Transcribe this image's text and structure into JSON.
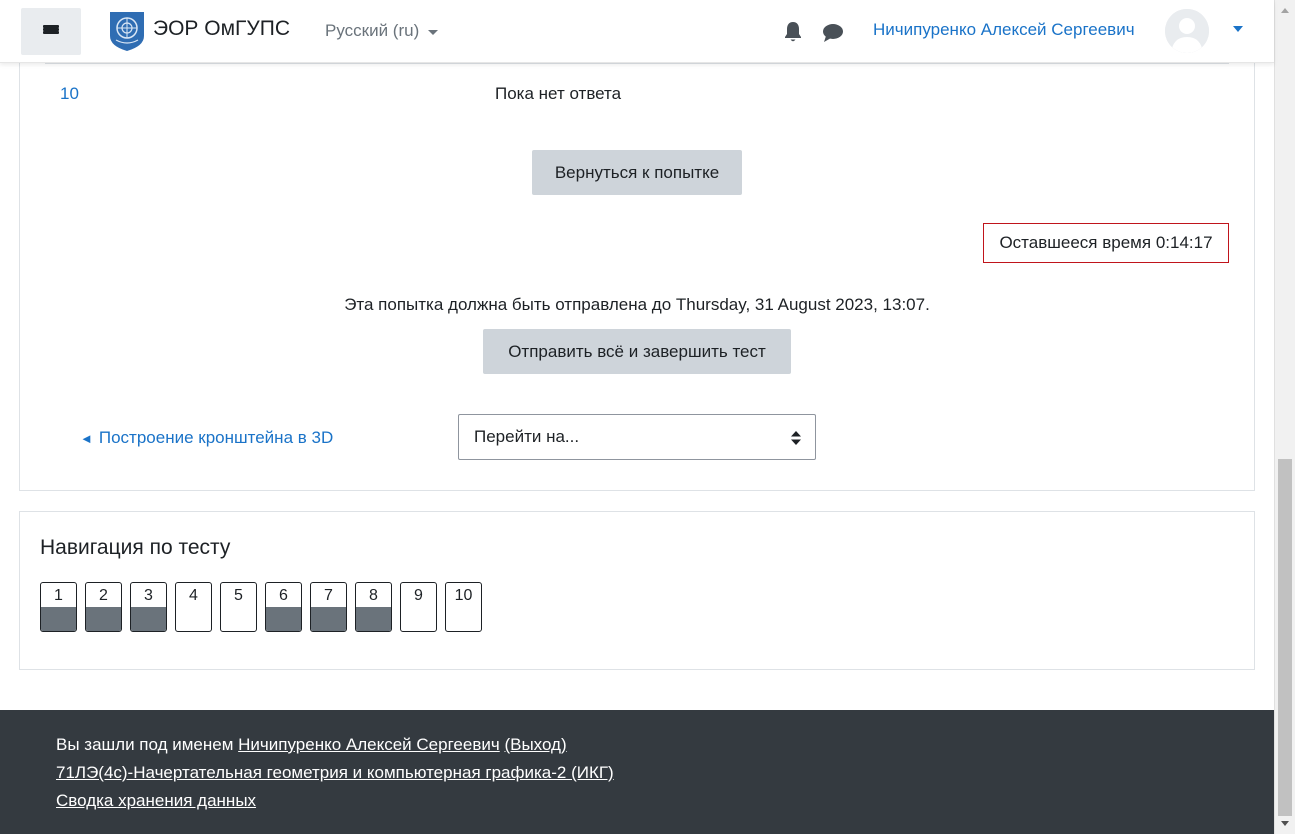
{
  "header": {
    "site_name": "ЭОР ОмГУПС",
    "language": "Русский (ru)",
    "user_name": "Ничипуренко Алексей Сергеевич"
  },
  "main": {
    "question_number": "10",
    "question_status": "Пока нет ответа",
    "return_button": "Вернуться к попытке",
    "timer_label": "Оставшееся время",
    "timer_value": "0:14:17",
    "deadline_text": "Эта попытка должна быть отправлена до Thursday, 31 August 2023, 13:07.",
    "submit_button": "Отправить всё и завершить тест",
    "prev_activity_link": "Построение кронштейна в 3D",
    "jump_to_placeholder": "Перейти на..."
  },
  "quiz_navigation": {
    "title": "Навигация по тесту",
    "questions": [
      {
        "label": "1",
        "answered": true
      },
      {
        "label": "2",
        "answered": true
      },
      {
        "label": "3",
        "answered": true
      },
      {
        "label": "4",
        "answered": false
      },
      {
        "label": "5",
        "answered": false
      },
      {
        "label": "6",
        "answered": true
      },
      {
        "label": "7",
        "answered": true
      },
      {
        "label": "8",
        "answered": true
      },
      {
        "label": "9",
        "answered": false
      },
      {
        "label": "10",
        "answered": false
      }
    ]
  },
  "footer": {
    "logged_in_prefix": "Вы зашли под именем",
    "user_name": "Ничипуренко Алексей Сергеевич",
    "logout_link": "(Выход)",
    "course_link": "71ЛЭ(4с)-Начертательная геометрия и компьютерная графика-2 (ИКГ)",
    "data_retention_link": "Сводка хранения данных"
  },
  "colors": {
    "link": "#1a73c8",
    "timer_border": "#c0141b",
    "button_bg": "#ced4da",
    "footer_bg": "#343a40",
    "answered_fill": "#6a737b"
  }
}
